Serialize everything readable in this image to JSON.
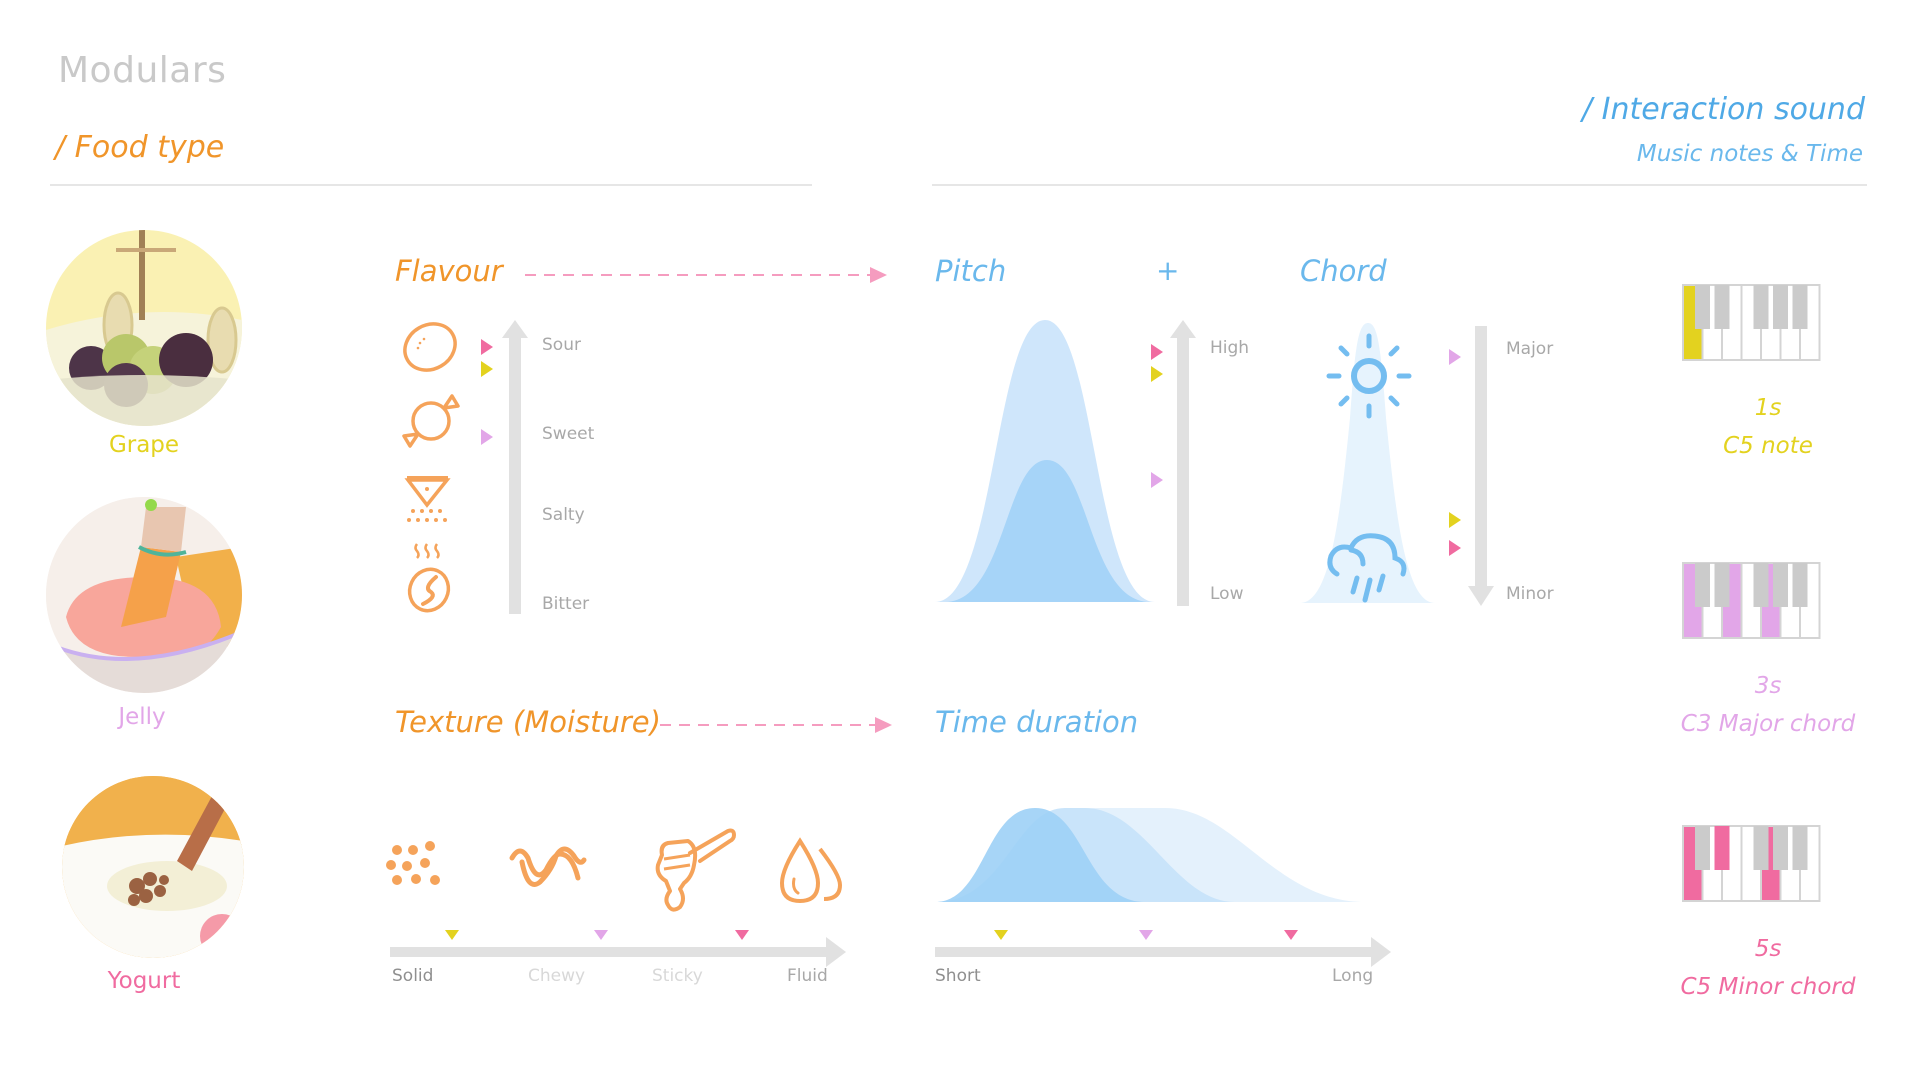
{
  "header": {
    "title": "Modulars",
    "left_section": "/ Food type",
    "right_section": "/ Interaction sound",
    "right_subtitle": "Music notes & Time"
  },
  "foods": [
    {
      "name": "Grape",
      "color": "#e3d21f",
      "icon": "grape-photo"
    },
    {
      "name": "Jelly",
      "color": "#e2a6e8",
      "icon": "jelly-photo"
    },
    {
      "name": "Yogurt",
      "color": "#f06ba0",
      "icon": "yogurt-photo"
    }
  ],
  "flavour": {
    "title": "Flavour",
    "axis_labels": [
      "Sour",
      "Sweet",
      "Salty",
      "Bitter"
    ],
    "icons": [
      "lemon-icon",
      "candy-icon",
      "salt-icon",
      "coffee-bean-icon"
    ],
    "markers": [
      {
        "food": "Yogurt",
        "color": "#f06ba0",
        "position": 0.06
      },
      {
        "food": "Grape",
        "color": "#e3d21f",
        "position": 0.14
      },
      {
        "food": "Jelly",
        "color": "#e2a6e8",
        "position": 0.38
      }
    ]
  },
  "pitch": {
    "title": "Pitch",
    "plus": "+",
    "axis_high": "High",
    "axis_low": "Low",
    "markers": [
      {
        "food": "Yogurt",
        "color": "#f06ba0",
        "position": 0.92
      },
      {
        "food": "Grape",
        "color": "#e3d21f",
        "position": 0.84
      },
      {
        "food": "Jelly",
        "color": "#e2a6e8",
        "position": 0.45
      }
    ]
  },
  "chord": {
    "title": "Chord",
    "axis_top": "Major",
    "axis_bottom": "Minor",
    "icons": [
      "sun-icon",
      "rain-cloud-icon"
    ],
    "markers": [
      {
        "food": "Jelly",
        "color": "#e2a6e8",
        "position": 0.1
      },
      {
        "food": "Grape",
        "color": "#e3d21f",
        "position": 0.7
      },
      {
        "food": "Yogurt",
        "color": "#f06ba0",
        "position": 0.8
      }
    ]
  },
  "texture": {
    "title": "Texture (Moisture)",
    "axis_labels": [
      "Solid",
      "Chewy",
      "Sticky",
      "Fluid"
    ],
    "icons": [
      "granules-icon",
      "noodle-icon",
      "honey-dipper-icon",
      "water-drops-icon"
    ],
    "markers": [
      {
        "food": "Grape",
        "color": "#e3d21f",
        "position": 0.14
      },
      {
        "food": "Jelly",
        "color": "#e2a6e8",
        "position": 0.48
      },
      {
        "food": "Yogurt",
        "color": "#f06ba0",
        "position": 0.8
      }
    ]
  },
  "time_duration": {
    "title": "Time duration",
    "axis_start": "Short",
    "axis_end": "Long",
    "markers": [
      {
        "food": "Grape",
        "color": "#e3d21f",
        "position": 0.15
      },
      {
        "food": "Jelly",
        "color": "#e2a6e8",
        "position": 0.48
      },
      {
        "food": "Yogurt",
        "color": "#f06ba0",
        "position": 0.81
      }
    ]
  },
  "sounds": [
    {
      "duration": "1s",
      "note": "C5 note",
      "color": "#e3d21f",
      "highlight_white": [
        0
      ],
      "highlight_black": []
    },
    {
      "duration": "3s",
      "note": "C3 Major chord",
      "color": "#e2a6e8",
      "highlight_white": [
        0,
        2,
        4
      ],
      "highlight_black": []
    },
    {
      "duration": "5s",
      "note": "C5 Minor chord",
      "color": "#f06ba0",
      "highlight_white": [
        0,
        4
      ],
      "highlight_black": [
        1
      ]
    }
  ]
}
